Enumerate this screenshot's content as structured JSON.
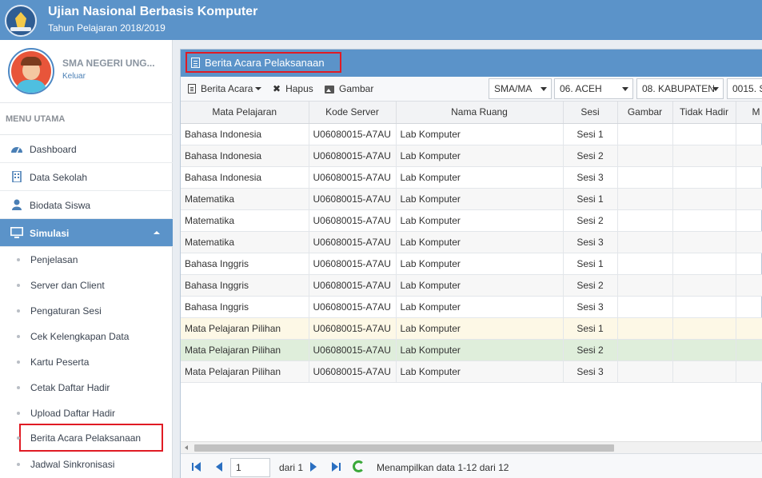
{
  "header": {
    "title": "Ujian Nasional Berbasis Komputer",
    "subtitle": "Tahun Pelajaran 2018/2019",
    "logo_icon": "tut-wuri-handayani-logo"
  },
  "profile": {
    "school_name": "SMA NEGERI UNG...",
    "logout_label": "Keluar"
  },
  "menu": {
    "heading": "MENU UTAMA",
    "items": [
      {
        "label": "Dashboard",
        "icon": "dashboard-icon"
      },
      {
        "label": "Data Sekolah",
        "icon": "building-icon"
      },
      {
        "label": "Biodata Siswa",
        "icon": "user-icon"
      },
      {
        "label": "Simulasi",
        "icon": "monitor-icon",
        "active": true
      }
    ],
    "subitems": [
      {
        "label": "Penjelasan"
      },
      {
        "label": "Server dan Client"
      },
      {
        "label": "Pengaturan Sesi"
      },
      {
        "label": "Cek Kelengkapan Data"
      },
      {
        "label": "Kartu Peserta"
      },
      {
        "label": "Cetak Daftar Hadir"
      },
      {
        "label": "Upload Daftar Hadir"
      },
      {
        "label": "Berita Acara Pelaksanaan",
        "highlighted": true
      },
      {
        "label": "Jadwal Sinkronisasi"
      }
    ]
  },
  "panel": {
    "title": "Berita Acara Pelaksanaan",
    "toolbar": {
      "berita_acara_label": "Berita Acara",
      "hapus_label": "Hapus",
      "gambar_label": "Gambar"
    },
    "filters": {
      "jenjang": "SMA/MA",
      "provinsi": "06. ACEH",
      "kabupaten": "08. KABUPATEN",
      "sekolah": "0015. S"
    },
    "columns": [
      "Mata Pelajaran",
      "Kode Server",
      "Nama Ruang",
      "Sesi",
      "Gambar",
      "Tidak Hadir",
      "M"
    ],
    "rows": [
      [
        "Bahasa Indonesia",
        "U06080015-A7AU",
        "Lab Komputer",
        "Sesi 1"
      ],
      [
        "Bahasa Indonesia",
        "U06080015-A7AU",
        "Lab Komputer",
        "Sesi 2"
      ],
      [
        "Bahasa Indonesia",
        "U06080015-A7AU",
        "Lab Komputer",
        "Sesi 3"
      ],
      [
        "Matematika",
        "U06080015-A7AU",
        "Lab Komputer",
        "Sesi 1"
      ],
      [
        "Matematika",
        "U06080015-A7AU",
        "Lab Komputer",
        "Sesi 2"
      ],
      [
        "Matematika",
        "U06080015-A7AU",
        "Lab Komputer",
        "Sesi 3"
      ],
      [
        "Bahasa Inggris",
        "U06080015-A7AU",
        "Lab Komputer",
        "Sesi 1"
      ],
      [
        "Bahasa Inggris",
        "U06080015-A7AU",
        "Lab Komputer",
        "Sesi 2"
      ],
      [
        "Bahasa Inggris",
        "U06080015-A7AU",
        "Lab Komputer",
        "Sesi 3"
      ],
      [
        "Mata Pelajaran Pilihan",
        "U06080015-A7AU",
        "Lab Komputer",
        "Sesi 1"
      ],
      [
        "Mata Pelajaran Pilihan",
        "U06080015-A7AU",
        "Lab Komputer",
        "Sesi 2"
      ],
      [
        "Mata Pelajaran Pilihan",
        "U06080015-A7AU",
        "Lab Komputer",
        "Sesi 3"
      ]
    ],
    "pager": {
      "page": "1",
      "of_label": "dari 1",
      "info": "Menampilkan data 1-12 dari 12"
    }
  },
  "colors": {
    "primary": "#5b93c9",
    "highlight_border": "#e01b24",
    "row_selected": "#dfeedb",
    "row_hover": "#fdf8e6"
  }
}
